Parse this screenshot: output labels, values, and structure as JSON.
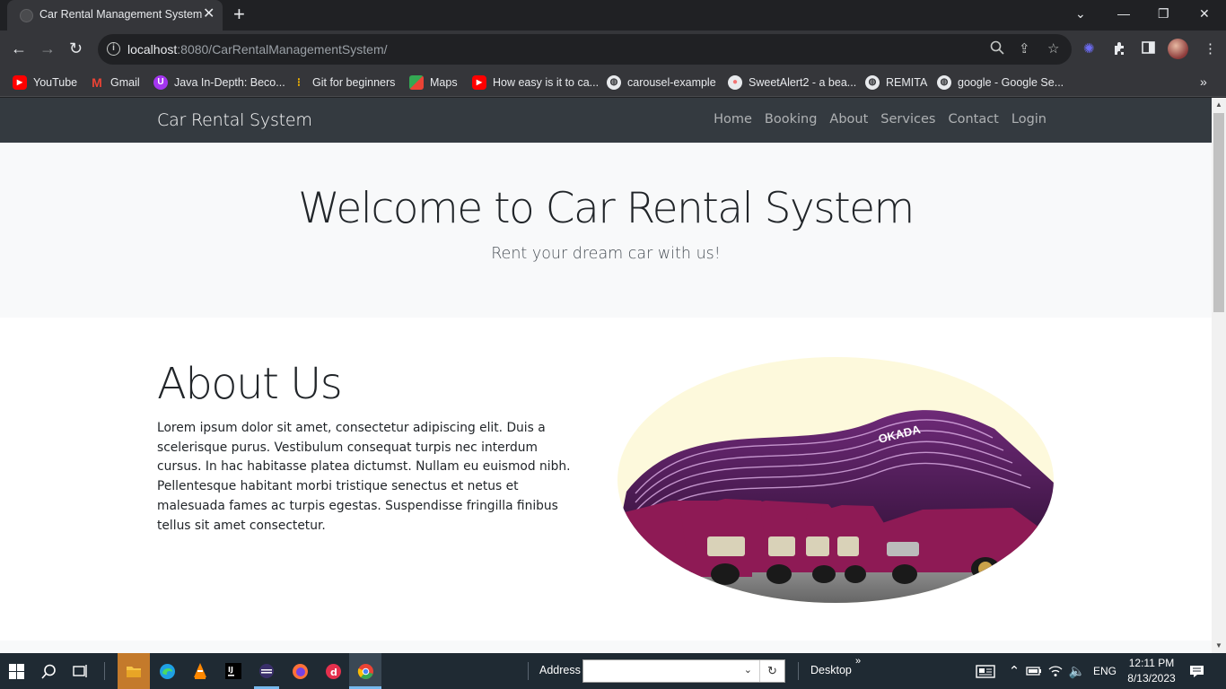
{
  "browser": {
    "tab_title": "Car Rental Management System",
    "url_host": "localhost",
    "url_rest": ":8080/CarRentalManagementSystem/",
    "bookmarks": [
      {
        "label": "YouTube",
        "icon": "youtube-icon",
        "color": "#ff0000"
      },
      {
        "label": "Gmail",
        "icon": "gmail-icon",
        "color": "#ea4335"
      },
      {
        "label": "Java In-Depth: Beco...",
        "icon": "udemy-icon",
        "color": "#a435f0"
      },
      {
        "label": "Git for beginners",
        "icon": "git-icon",
        "color": "#f4b400"
      },
      {
        "label": "Maps",
        "icon": "maps-icon",
        "color": "#34a853"
      },
      {
        "label": "How easy is it to ca...",
        "icon": "youtube-icon",
        "color": "#ff0000"
      },
      {
        "label": "carousel-example",
        "icon": "globe-icon",
        "color": "#e8eaed"
      },
      {
        "label": "SweetAlert2 - a bea...",
        "icon": "sweetalert-icon",
        "color": "#f27474"
      },
      {
        "label": "REMITA",
        "icon": "globe-icon",
        "color": "#e8eaed"
      },
      {
        "label": "google - Google Se...",
        "icon": "globe-icon",
        "color": "#e8eaed"
      }
    ]
  },
  "site": {
    "brand": "Car Rental System",
    "nav": [
      "Home",
      "Booking",
      "About",
      "Services",
      "Contact",
      "Login"
    ],
    "hero": {
      "title": "Welcome to Car Rental System",
      "subtitle": "Rent your dream car with us!"
    },
    "about": {
      "title": "About Us",
      "text": "Lorem ipsum dolor sit amet, consectetur adipiscing elit. Duis a scelerisque purus. Vestibulum consequat turpis nec interdum cursus. In hac habitasse platea dictumst. Nullam eu euismod nibh. Pellentesque habitant morbi tristique senectus et netus et malesuada fames ac turpis egestas. Suspendisse fringilla finibus tellus sit amet consectetur.",
      "image_sign": "OKADA"
    }
  },
  "taskbar": {
    "address_label": "Address",
    "address_value": "",
    "desktop_label": "Desktop",
    "language": "ENG",
    "time": "12:11 PM",
    "date": "8/13/2023"
  },
  "colors": {
    "navbar": "#343a40",
    "hero_bg": "#f8f9fa",
    "image_bg": "#fdf9dc",
    "car_color": "#8e1a55"
  }
}
